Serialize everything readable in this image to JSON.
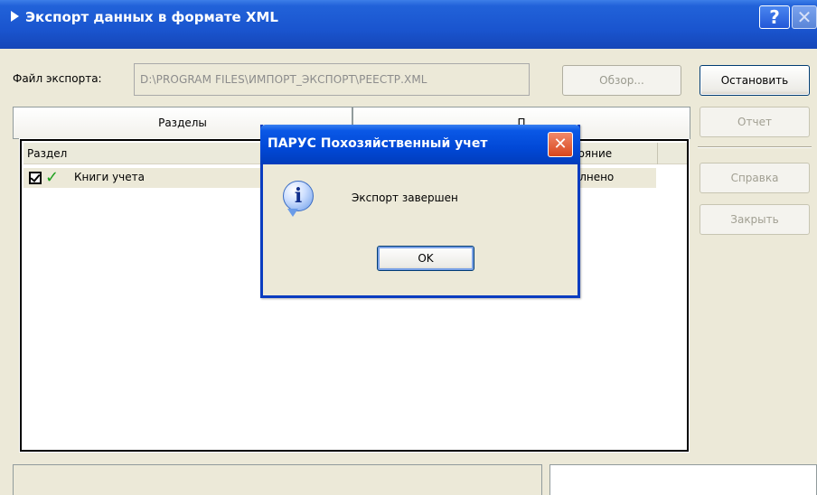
{
  "window": {
    "title": "Экспорт данных в формате XML",
    "help_label": "?",
    "close_label": "✕"
  },
  "export": {
    "file_label": "Файл экспорта:",
    "file_path": "D:\\PROGRAM FILES\\ИМПОРТ_ЭКСПОРТ\\РЕЕСТР.XML",
    "browse_label": "Обзор..."
  },
  "buttons": {
    "stop": "Остановить",
    "report": "Отчет",
    "help": "Справка",
    "close": "Закрыть"
  },
  "tabs": [
    {
      "label": "Разделы"
    },
    {
      "label": "П"
    }
  ],
  "list": {
    "columns": [
      "Раздел",
      "Состояние"
    ],
    "column_visible_labels": [
      "Раздел",
      "стояние"
    ],
    "rows": [
      {
        "name": "Книги учета",
        "status": "Выполнено",
        "status_visible": "полнено",
        "checked": true
      }
    ]
  },
  "message_box": {
    "title": "ПАРУС Похозяйственный учет",
    "text": "Экспорт завершен",
    "ok_label": "OK",
    "icon": "info-icon",
    "close_label": "✕"
  },
  "colors": {
    "titlebar": "#1a55cf",
    "dialog_bg": "#ece9d8",
    "check_green": "#1da01d",
    "close_red": "#d8461c"
  }
}
